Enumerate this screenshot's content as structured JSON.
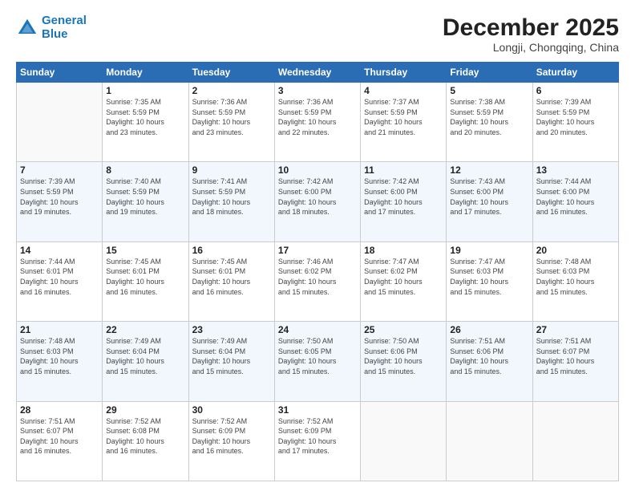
{
  "logo": {
    "line1": "General",
    "line2": "Blue"
  },
  "header": {
    "month": "December 2025",
    "location": "Longji, Chongqing, China"
  },
  "weekdays": [
    "Sunday",
    "Monday",
    "Tuesday",
    "Wednesday",
    "Thursday",
    "Friday",
    "Saturday"
  ],
  "weeks": [
    [
      {
        "day": "",
        "info": ""
      },
      {
        "day": "1",
        "info": "Sunrise: 7:35 AM\nSunset: 5:59 PM\nDaylight: 10 hours\nand 23 minutes."
      },
      {
        "day": "2",
        "info": "Sunrise: 7:36 AM\nSunset: 5:59 PM\nDaylight: 10 hours\nand 23 minutes."
      },
      {
        "day": "3",
        "info": "Sunrise: 7:36 AM\nSunset: 5:59 PM\nDaylight: 10 hours\nand 22 minutes."
      },
      {
        "day": "4",
        "info": "Sunrise: 7:37 AM\nSunset: 5:59 PM\nDaylight: 10 hours\nand 21 minutes."
      },
      {
        "day": "5",
        "info": "Sunrise: 7:38 AM\nSunset: 5:59 PM\nDaylight: 10 hours\nand 20 minutes."
      },
      {
        "day": "6",
        "info": "Sunrise: 7:39 AM\nSunset: 5:59 PM\nDaylight: 10 hours\nand 20 minutes."
      }
    ],
    [
      {
        "day": "7",
        "info": "Sunrise: 7:39 AM\nSunset: 5:59 PM\nDaylight: 10 hours\nand 19 minutes."
      },
      {
        "day": "8",
        "info": "Sunrise: 7:40 AM\nSunset: 5:59 PM\nDaylight: 10 hours\nand 19 minutes."
      },
      {
        "day": "9",
        "info": "Sunrise: 7:41 AM\nSunset: 5:59 PM\nDaylight: 10 hours\nand 18 minutes."
      },
      {
        "day": "10",
        "info": "Sunrise: 7:42 AM\nSunset: 6:00 PM\nDaylight: 10 hours\nand 18 minutes."
      },
      {
        "day": "11",
        "info": "Sunrise: 7:42 AM\nSunset: 6:00 PM\nDaylight: 10 hours\nand 17 minutes."
      },
      {
        "day": "12",
        "info": "Sunrise: 7:43 AM\nSunset: 6:00 PM\nDaylight: 10 hours\nand 17 minutes."
      },
      {
        "day": "13",
        "info": "Sunrise: 7:44 AM\nSunset: 6:00 PM\nDaylight: 10 hours\nand 16 minutes."
      }
    ],
    [
      {
        "day": "14",
        "info": "Sunrise: 7:44 AM\nSunset: 6:01 PM\nDaylight: 10 hours\nand 16 minutes."
      },
      {
        "day": "15",
        "info": "Sunrise: 7:45 AM\nSunset: 6:01 PM\nDaylight: 10 hours\nand 16 minutes."
      },
      {
        "day": "16",
        "info": "Sunrise: 7:45 AM\nSunset: 6:01 PM\nDaylight: 10 hours\nand 16 minutes."
      },
      {
        "day": "17",
        "info": "Sunrise: 7:46 AM\nSunset: 6:02 PM\nDaylight: 10 hours\nand 15 minutes."
      },
      {
        "day": "18",
        "info": "Sunrise: 7:47 AM\nSunset: 6:02 PM\nDaylight: 10 hours\nand 15 minutes."
      },
      {
        "day": "19",
        "info": "Sunrise: 7:47 AM\nSunset: 6:03 PM\nDaylight: 10 hours\nand 15 minutes."
      },
      {
        "day": "20",
        "info": "Sunrise: 7:48 AM\nSunset: 6:03 PM\nDaylight: 10 hours\nand 15 minutes."
      }
    ],
    [
      {
        "day": "21",
        "info": "Sunrise: 7:48 AM\nSunset: 6:03 PM\nDaylight: 10 hours\nand 15 minutes."
      },
      {
        "day": "22",
        "info": "Sunrise: 7:49 AM\nSunset: 6:04 PM\nDaylight: 10 hours\nand 15 minutes."
      },
      {
        "day": "23",
        "info": "Sunrise: 7:49 AM\nSunset: 6:04 PM\nDaylight: 10 hours\nand 15 minutes."
      },
      {
        "day": "24",
        "info": "Sunrise: 7:50 AM\nSunset: 6:05 PM\nDaylight: 10 hours\nand 15 minutes."
      },
      {
        "day": "25",
        "info": "Sunrise: 7:50 AM\nSunset: 6:06 PM\nDaylight: 10 hours\nand 15 minutes."
      },
      {
        "day": "26",
        "info": "Sunrise: 7:51 AM\nSunset: 6:06 PM\nDaylight: 10 hours\nand 15 minutes."
      },
      {
        "day": "27",
        "info": "Sunrise: 7:51 AM\nSunset: 6:07 PM\nDaylight: 10 hours\nand 15 minutes."
      }
    ],
    [
      {
        "day": "28",
        "info": "Sunrise: 7:51 AM\nSunset: 6:07 PM\nDaylight: 10 hours\nand 16 minutes."
      },
      {
        "day": "29",
        "info": "Sunrise: 7:52 AM\nSunset: 6:08 PM\nDaylight: 10 hours\nand 16 minutes."
      },
      {
        "day": "30",
        "info": "Sunrise: 7:52 AM\nSunset: 6:09 PM\nDaylight: 10 hours\nand 16 minutes."
      },
      {
        "day": "31",
        "info": "Sunrise: 7:52 AM\nSunset: 6:09 PM\nDaylight: 10 hours\nand 17 minutes."
      },
      {
        "day": "",
        "info": ""
      },
      {
        "day": "",
        "info": ""
      },
      {
        "day": "",
        "info": ""
      }
    ]
  ]
}
